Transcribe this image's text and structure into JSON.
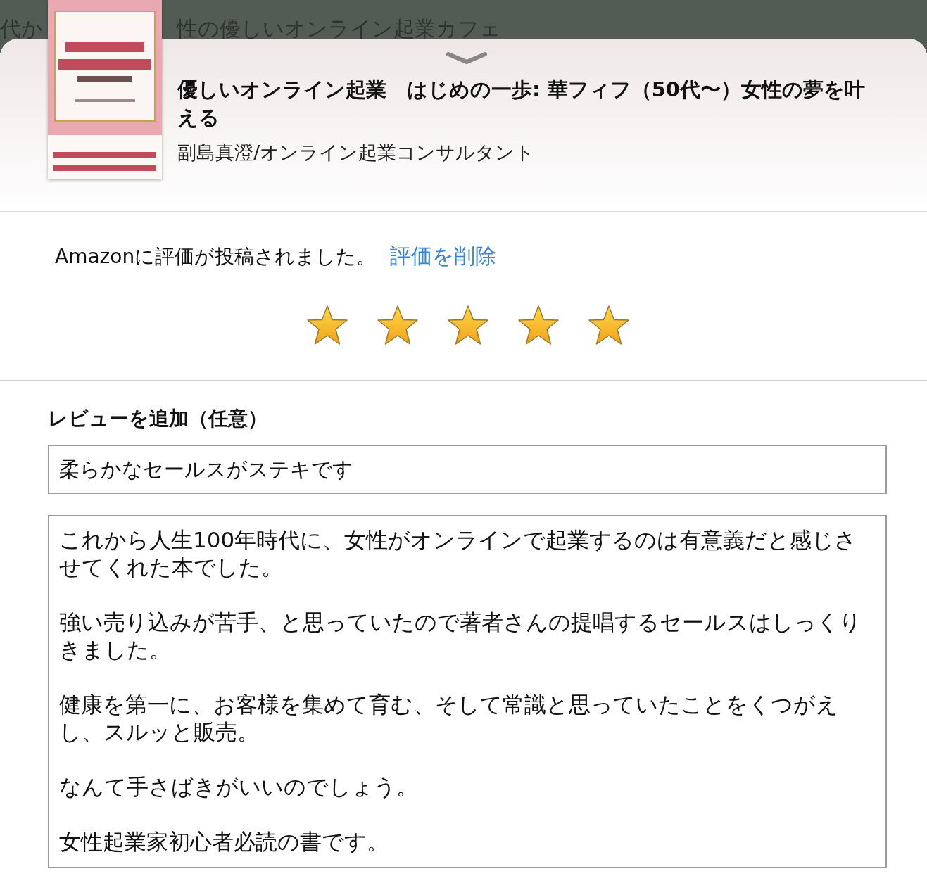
{
  "background_texts": [
    "代か",
    "性の優しいオンライン起業カフェ"
  ],
  "book": {
    "title": "優しいオンライン起業　はじめの一歩: 華フィフ（50代〜）女性の夢を叶える",
    "author": "副島真澄/オンライン起業コンサルタント"
  },
  "rating": {
    "message": "Amazonに評価が投稿されました。",
    "delete_link": "評価を削除",
    "stars": 5
  },
  "review": {
    "heading": "レビューを追加（任意）",
    "headline_value": "柔らかなセールスがステキです",
    "body_paragraphs": [
      "これから人生100年時代に、女性がオンラインで起業するのは有意義だと感じさせてくれた本でした。",
      "強い売り込みが苦手、と思っていたので著者さんの提唱するセールスはしっくりきました。",
      "健康を第一に、お客様を集めて育む、そして常識と思っていたことをくつがえし、スルッと販売。",
      "なんて手さばきがいいのでしょう。",
      "女性起業家初心者必読の書です。"
    ]
  }
}
